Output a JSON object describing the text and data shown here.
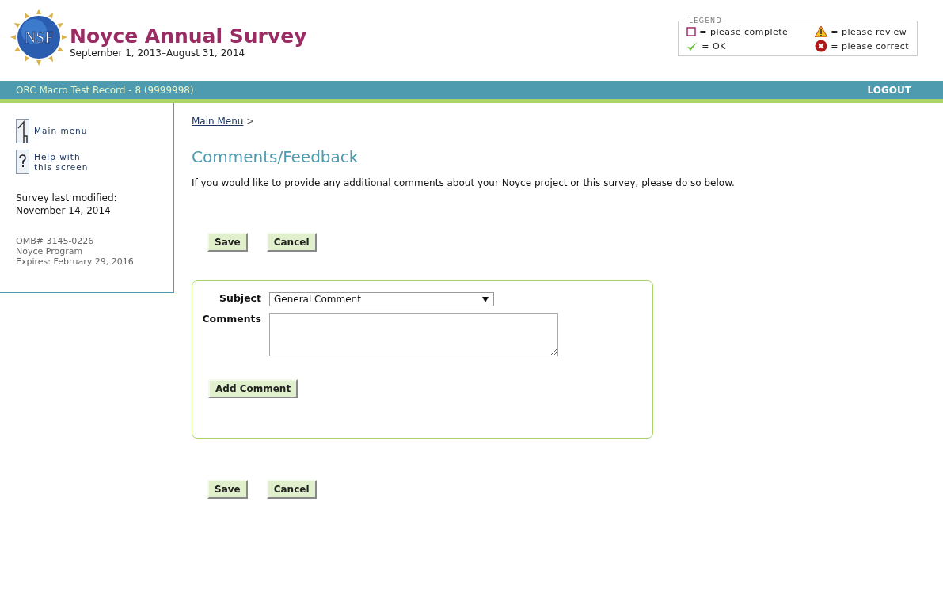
{
  "header": {
    "title": "Noyce Annual Survey",
    "period": "September 1, 2013–August 31, 2014",
    "logo_text": "NSF"
  },
  "legend": {
    "title": "LEGEND",
    "items": [
      {
        "kind": "incomplete",
        "label": "= please complete"
      },
      {
        "kind": "review",
        "label": "= please review"
      },
      {
        "kind": "ok",
        "label": "= OK"
      },
      {
        "kind": "error",
        "label": "= please correct"
      }
    ]
  },
  "nav_bar": {
    "record": "ORC Macro Test Record - 8 (9999998)",
    "logout": "LOGOUT"
  },
  "sidebar": {
    "links": [
      {
        "kind": "home",
        "lines": [
          "Main menu"
        ]
      },
      {
        "kind": "help",
        "lines": [
          "Help with",
          "this screen"
        ]
      }
    ],
    "modified_label": "Survey last modified:",
    "modified_date": "November 14, 2014",
    "omb": [
      "OMB# 3145-0226",
      "Noyce Program",
      "Expires: February 29, 2016"
    ]
  },
  "breadcrumb": {
    "link": "Main Menu",
    "separator": ">"
  },
  "page_title": "Comments/Feedback",
  "intro": "If you would like to provide any additional comments about your Noyce project or this survey, please do so below.",
  "top_buttons": [
    "Save",
    "Cancel"
  ],
  "form": {
    "subject_label": "Subject",
    "subject_value": "General Comment",
    "comments_label": "Comments",
    "add_button": "Add Comment"
  },
  "bottom_buttons": [
    "Save",
    "Cancel"
  ]
}
